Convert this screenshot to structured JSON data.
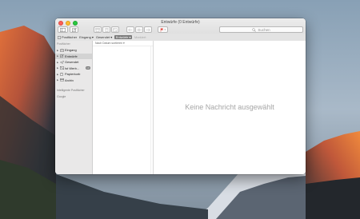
{
  "window": {
    "title": "Entwürfe (0 Entwürfe)"
  },
  "toolbar": {
    "buttons": [
      {
        "name": "mailbox-toggle-button",
        "icon": "mailbox-icon"
      },
      {
        "name": "compose-button",
        "icon": "compose-icon"
      },
      {
        "name": "archive-button",
        "icon": "archive-icon"
      },
      {
        "name": "delete-button",
        "icon": "trash-icon"
      },
      {
        "name": "junk-button",
        "icon": "junk-icon"
      },
      {
        "name": "reply-button",
        "icon": "reply-icon"
      },
      {
        "name": "reply-all-button",
        "icon": "reply-all-icon"
      },
      {
        "name": "forward-button",
        "icon": "forward-icon"
      },
      {
        "name": "flag-button",
        "icon": "flag-icon"
      }
    ],
    "search_placeholder": "Suchen"
  },
  "favorites": {
    "items": [
      {
        "label": "Postfächer",
        "state": "normal"
      },
      {
        "label": "Eingang",
        "state": "normal"
      },
      {
        "label": "Gesendet",
        "state": "normal"
      },
      {
        "label": "Entwürfe",
        "state": "active"
      },
      {
        "label": "Markiert",
        "state": "disabled"
      }
    ]
  },
  "sidebar": {
    "section_title": "Postfächer",
    "items": [
      {
        "label": "Eingang",
        "icon": "inbox-icon",
        "selected": false
      },
      {
        "label": "Entwürfe",
        "icon": "drafts-icon",
        "selected": true
      },
      {
        "label": "Gesendet",
        "icon": "sent-icon",
        "selected": false
      },
      {
        "label": "Ist Werb...",
        "icon": "junk-icon",
        "selected": false,
        "badge": "13"
      },
      {
        "label": "Papierkorb",
        "icon": "trash-icon",
        "selected": false
      },
      {
        "label": "Archiv",
        "icon": "archive-icon",
        "selected": false
      }
    ],
    "smart_mailboxes": "Intelligente Postfächer",
    "google": "Google"
  },
  "message_list": {
    "sort_label": "Nach Datum sortieren"
  },
  "preview": {
    "empty_text": "Keine Nachricht ausgewählt"
  },
  "colors": {
    "selection": "#d3d3d3",
    "flag": "#e0463c",
    "close": "#fc5f57",
    "minimize": "#fdbc2e",
    "zoom": "#28c940"
  }
}
